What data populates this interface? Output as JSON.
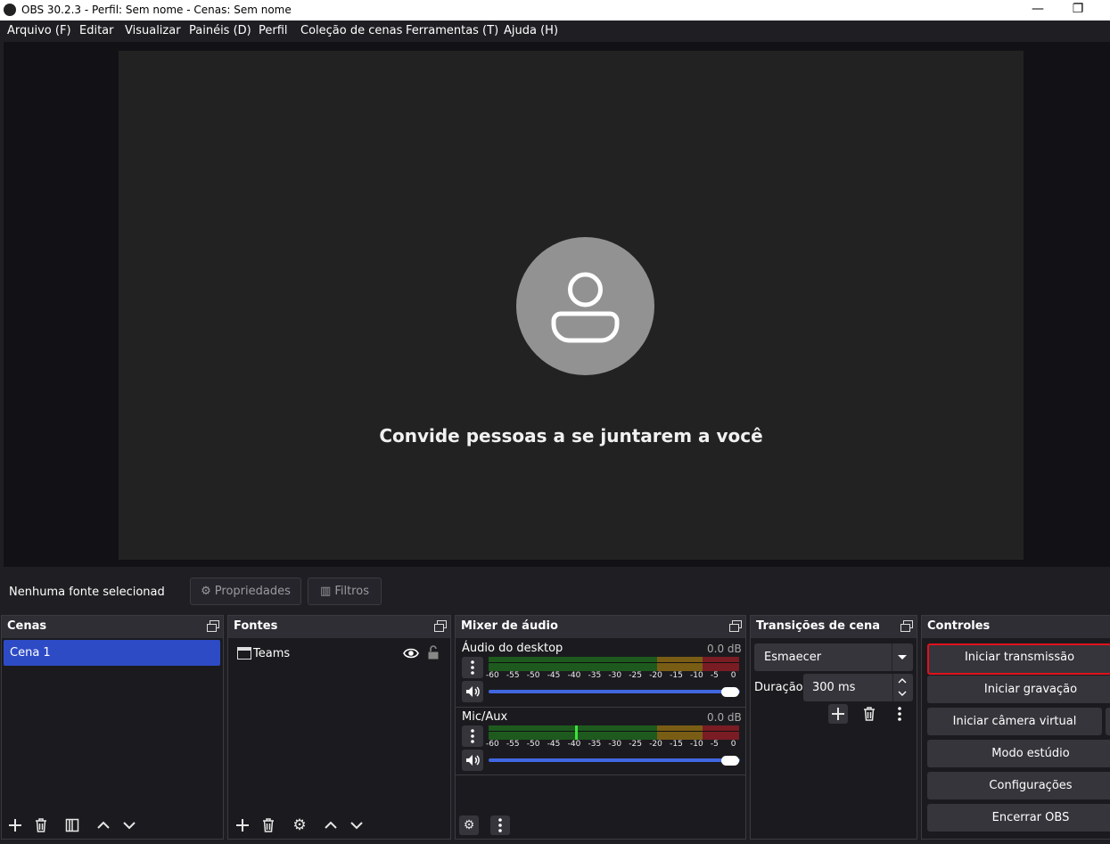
{
  "window": {
    "title": "OBS 30.2.3 - Perfil: Sem nome - Cenas: Sem nome",
    "minimize": "—",
    "restore": "❐"
  },
  "menu": [
    "Arquivo (F)",
    "Editar",
    "Visualizar",
    "Painéis (D)",
    "Perfil",
    "Coleção de cenas",
    "Ferramentas (T)",
    "Ajuda (H)"
  ],
  "preview": {
    "invite_text": "Convide pessoas a se juntarem a você"
  },
  "source_toolbar": {
    "no_source": "Nenhuma fonte selecionad",
    "properties": "Propriedades",
    "filters": "Filtros"
  },
  "scenes": {
    "title": "Cenas",
    "items": [
      "Cena 1"
    ]
  },
  "sources": {
    "title": "Fontes",
    "items": [
      {
        "name": "Teams",
        "visible": true,
        "locked": false
      }
    ]
  },
  "mixer": {
    "title": "Mixer de áudio",
    "channels": [
      {
        "name": "Áudio do desktop",
        "level": "0.0 dB",
        "volume": 1.0
      },
      {
        "name": "Mic/Aux",
        "level": "0.0 dB",
        "volume": 1.0
      }
    ],
    "scale": [
      "-60",
      "-55",
      "-50",
      "-45",
      "-40",
      "-35",
      "-30",
      "-25",
      "-20",
      "-15",
      "-10",
      "-5",
      "0"
    ]
  },
  "transitions": {
    "title": "Transições de cena",
    "selected": "Esmaecer",
    "duration_label": "Duração",
    "duration_value": "300 ms"
  },
  "controls": {
    "title": "Controles",
    "start_stream": "Iniciar transmissão",
    "start_record": "Iniciar gravação",
    "start_virtualcam": "Iniciar câmera virtual",
    "studio_mode": "Modo estúdio",
    "settings": "Configurações",
    "exit": "Encerrar OBS"
  },
  "colors": {
    "accent_selection": "#2e4bc6",
    "highlight_border": "#e0121c",
    "meter_green": "#1e5a1e",
    "meter_yellow": "#7a5d15",
    "meter_red": "#7a1c24"
  }
}
